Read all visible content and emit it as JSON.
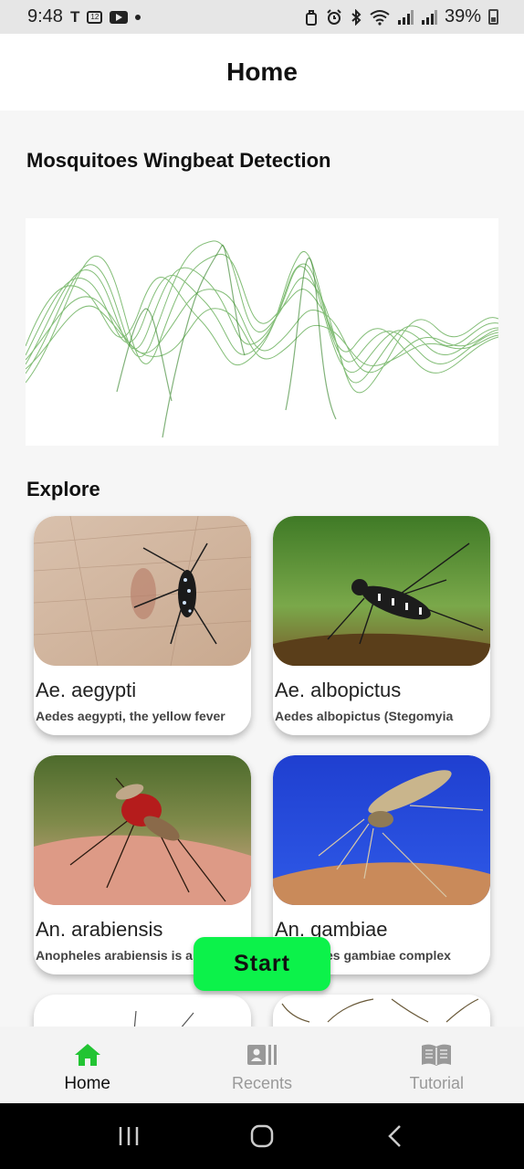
{
  "status_bar": {
    "time": "9:48",
    "battery": "39%"
  },
  "app_bar": {
    "title": "Home"
  },
  "main": {
    "heading": "Mosquitoes Wingbeat Detection",
    "explore_label": "Explore",
    "cards": [
      {
        "title": "Ae. aegypti",
        "description": "Aedes aegypti, the yellow fever",
        "image_icon": "mosquito-on-skin-photo"
      },
      {
        "title": "Ae. albopictus",
        "description": "Aedes albopictus (Stegomyia",
        "image_icon": "mosquito-on-leaf-photo"
      },
      {
        "title": "An. arabiensis",
        "description": "Anopheles arabiensis is a",
        "image_icon": "mosquito-feeding-photo"
      },
      {
        "title": "An. gambiae",
        "description": "Anopheles gambiae complex",
        "image_icon": "mosquito-blue-bg-photo"
      }
    ],
    "start_label": "Start"
  },
  "bottom_nav": {
    "items": [
      {
        "label": "Home",
        "icon": "home-icon",
        "active": true
      },
      {
        "label": "Recents",
        "icon": "recents-icon",
        "active": false
      },
      {
        "label": "Tutorial",
        "icon": "book-icon",
        "active": false
      }
    ]
  },
  "colors": {
    "accent": "#0cf24a",
    "nav_active_icon": "#22c433",
    "waveform": "#3f9a2e"
  }
}
